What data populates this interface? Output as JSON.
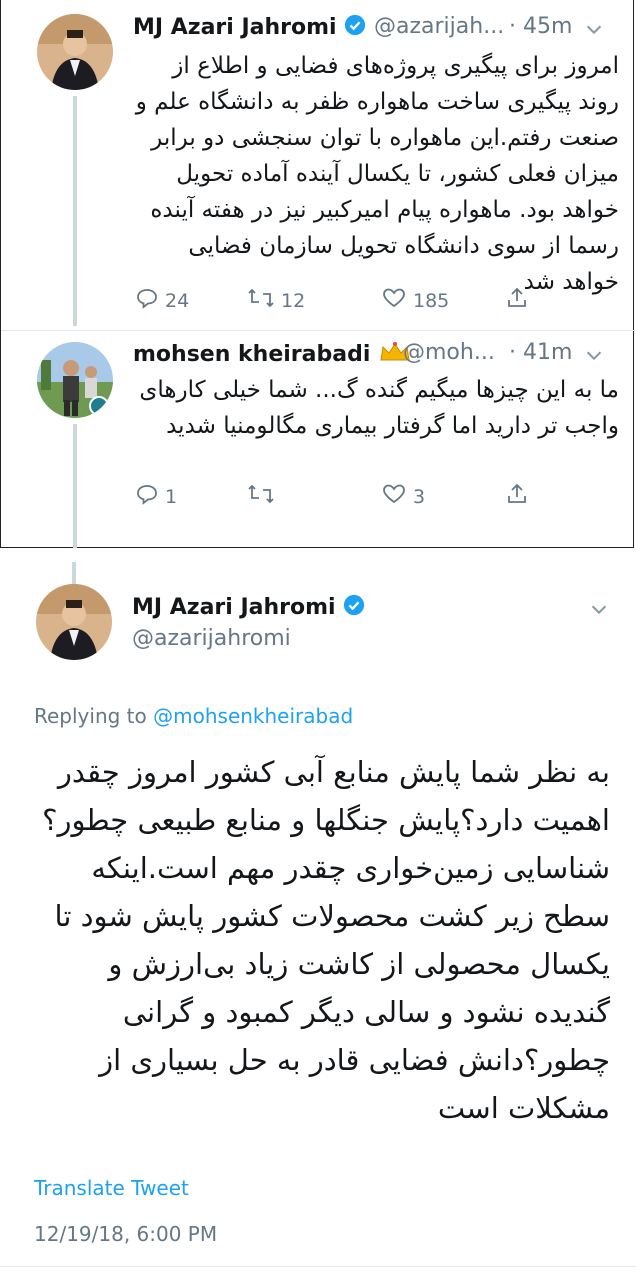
{
  "tweet1": {
    "name": "MJ Azari Jahromi",
    "handle": "@azarijah...",
    "time": "· 45m",
    "text": "امروز برای پیگیری پروژه‌های فضایی و اطلاع از روند پیگیری ساخت ماهواره ظفر به دانشگاه علم و صنعت رفتم.این ماهواره با توان سنجشی دو برابر میزان فعلی کشور، تا یکسال آینده آماده تحویل خواهد بود. ماهواره پیام امیرکبیر نیز در هفته آینده رسما از سوی دانشگاه تحویل سازمان فضایی خواهد شد",
    "replies": "24",
    "retweets": "12",
    "likes": "185"
  },
  "tweet2": {
    "name": "mohsen kheirabadi",
    "handle": "@moh...",
    "time": "· 41m",
    "text": "ما به این چیزها میگیم گنده گ... شما خیلی کارهای واجب تر دارید اما گرفتار بیماری مگالومنیا شدید",
    "replies": "1",
    "retweets": "",
    "likes": "3"
  },
  "tweet3": {
    "name": "MJ Azari Jahromi",
    "handle": "@azarijahromi",
    "replying_prefix": "Replying to",
    "replying_to": "@mohsenkheirabad",
    "text": "به نظر شما پایش منابع آبی کشور امروز چقدر اهمیت دارد؟پایش جنگلها و منابع طبیعی چطور؟شناسایی زمین‌خواری چقدر مهم است.اینکه سطح زیر کشت محصولات کشور پایش شود تا یکسال محصولی از کاشت زیاد بی‌ارزش و گندیده نشود و سالی دیگر کمبود و گرانی چطور؟دانش فضایی قادر به حل بسیاری از مشکلات است",
    "translate": "Translate Tweet",
    "timestamp": "12/19/18, 6:00 PM"
  },
  "colors": {
    "accent": "#1da1f2",
    "muted": "#657786",
    "text": "#14171a"
  },
  "icons": [
    "verified-icon",
    "crown-icon",
    "chevron-down-icon",
    "reply-icon",
    "retweet-icon",
    "like-icon",
    "share-icon"
  ]
}
